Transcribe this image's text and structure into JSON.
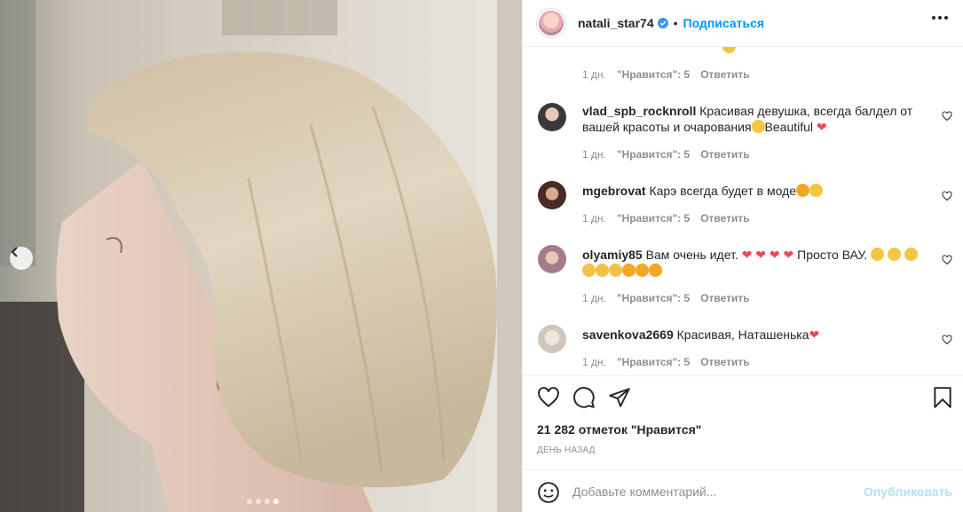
{
  "post": {
    "username": "natali_star74",
    "dot": "•",
    "follow_label": "Подписаться"
  },
  "comments": [
    {
      "user": "",
      "text": "",
      "time": "1 дн.",
      "likes": "\"Нравится\": 5",
      "reply": "Ответить"
    },
    {
      "user": "vlad_spb_rocknroll",
      "text_a": "Красивая девушка, всегда балдел от вашей красоты и очарования",
      "text_b": "Beautiful",
      "time": "1 дн.",
      "likes": "\"Нравится\": 5",
      "reply": "Ответить"
    },
    {
      "user": "mgebrovat",
      "text_a": "Карэ всегда будет в моде",
      "time": "1 дн.",
      "likes": "\"Нравится\": 5",
      "reply": "Ответить"
    },
    {
      "user": "olyamiy85",
      "text_a": "Вам очень идет.",
      "text_b": "Просто ВАУ.",
      "time": "1 дн.",
      "likes": "\"Нравится\": 5",
      "reply": "Ответить"
    },
    {
      "user": "savenkova2669",
      "text_a": "Красивая, Наташенька",
      "time": "1 дн.",
      "likes": "\"Нравится\": 5",
      "reply": "Ответить"
    }
  ],
  "footer": {
    "likes_count": "21 282 отметок \"Нравится\"",
    "posted_ago": "день назад",
    "comment_placeholder": "Добавьте комментарий...",
    "publish_label": "Опубликовать"
  },
  "icons": {
    "like": "heart-icon",
    "comment": "comment-icon",
    "share": "share-icon",
    "save": "bookmark-icon",
    "emoji": "smile-icon",
    "verified": "verified-badge-icon",
    "more": "more-options-icon",
    "prev": "chevron-left-icon"
  },
  "carousel": {
    "slides_total": 4,
    "active_slide": 4
  },
  "colors": {
    "accent": "#0095f6",
    "verified": "#3897f0",
    "heart_red": "#ed4956",
    "publish_disabled": "#b2dffc"
  }
}
